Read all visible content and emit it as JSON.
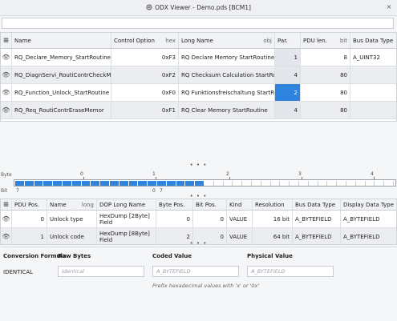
{
  "window": {
    "title": "ODX Viewer - Demo.pds [BCM1]",
    "close_glyph": "×"
  },
  "search": {
    "placeholder": ""
  },
  "services": {
    "headers": {
      "name": "Name",
      "option": "Control Option",
      "option_unit": "hex",
      "long": "Long Name",
      "long_unit": "obj",
      "par": "Par.",
      "pdu": "PDU len.",
      "pdu_unit": "bit",
      "bus": "Bus Data Type"
    },
    "rows": [
      {
        "name": "RQ_Declare_Memory_StartRoutine",
        "option": "0xF3",
        "long": "RQ Declare Memory StartRoutine",
        "par": "1",
        "pdu": "8",
        "bus": "A_UINT32"
      },
      {
        "name": "RQ_DiagnServi_RoutiContrCheckMemor",
        "option": "0xF2",
        "long": "RQ Checksum Calculation StartRoutine",
        "par": "4",
        "pdu": "80",
        "bus": ""
      },
      {
        "name": "RQ_Function_Unlock_StartRoutine",
        "option": "0xF0",
        "long": "RQ Funktionsfreischaltung StartRoutine",
        "par": "2",
        "pdu": "80",
        "bus": ""
      },
      {
        "name": "RQ_Req_RoutiContrEraseMemor",
        "option": "0xF1",
        "long": "RQ Clear Memory StartRoutine",
        "par": "4",
        "pdu": "80",
        "bus": ""
      }
    ],
    "selected_row": 2
  },
  "splitter_glyph": "• • •",
  "bitmap": {
    "byte_label": "Byte",
    "bit_label": "Bit",
    "byte_marks": [
      "0",
      "1",
      "2",
      "3",
      "4"
    ],
    "bit_marks": [
      "7",
      "0",
      "7"
    ],
    "highlighted_blocks": 20
  },
  "params": {
    "headers": {
      "pdu": "PDU Pos.",
      "name": "Name",
      "name_unit": "long",
      "dop": "DOP Long Name",
      "bytepos": "Byte Pos.",
      "bitpos": "Bit Pos.",
      "kind": "Kind",
      "res": "Resolution",
      "bus": "Bus Data Type",
      "disp": "Display Data Type"
    },
    "rows": [
      {
        "pdu": "0",
        "name": "Unlock type",
        "dop": "HexDump [2Byte] Field",
        "bytepos": "0",
        "bitpos": "0",
        "kind": "VALUE",
        "res": "16 bit",
        "bus": "A_BYTEFIELD",
        "disp": "A_BYTEFIELD"
      },
      {
        "pdu": "1",
        "name": "Unlock code",
        "dop": "HexDump [8Byte] Field",
        "bytepos": "2",
        "bitpos": "0",
        "kind": "VALUE",
        "res": "64 bit",
        "bus": "A_BYTEFIELD",
        "disp": "A_BYTEFIELD"
      }
    ]
  },
  "conversion": {
    "formula_label": "Conversion Formula",
    "formula_value": "IDENTICAL",
    "raw_label": "Raw Bytes",
    "raw_placeholder": "Identical",
    "coded_label": "Coded Value",
    "coded_placeholder": "A_BYTEFIELD",
    "physical_label": "Physical Value",
    "physical_placeholder": "A_BYTEFIELD",
    "hint": "Prefix hexadecimal values with 'x' or '0x'"
  }
}
